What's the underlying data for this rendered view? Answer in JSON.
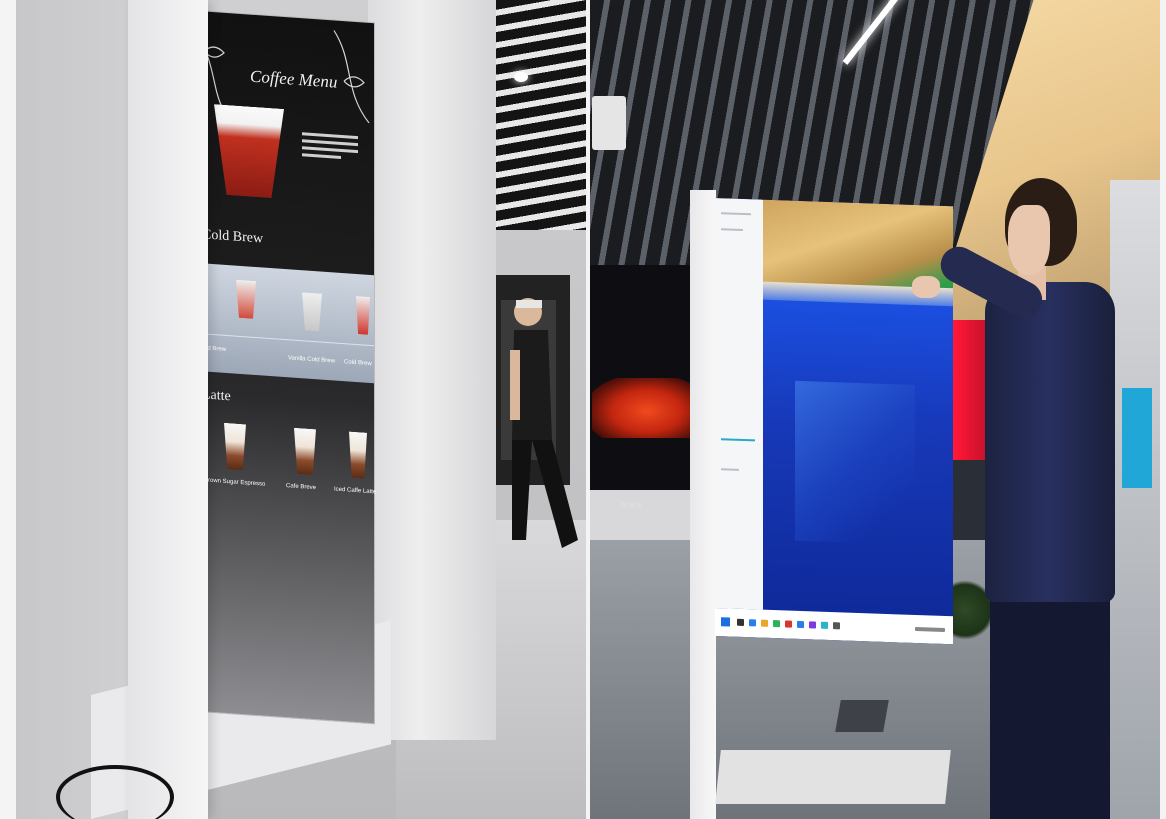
{
  "left_photo": {
    "screen": {
      "title": "Coffee Menu",
      "section_cold": "Cold Brew",
      "section_latte": "Latte",
      "cold_items": [
        "Nitro Cold Brew",
        "Vanilla Cold Brew",
        "Cold Brew"
      ],
      "latte_items": [
        "Brown Sugar Espresso",
        "Cafe Breve",
        "Iced Caffe Latte"
      ]
    }
  },
  "right_photo": {
    "screen": {
      "content": "map-application",
      "taskbar_icons": 10
    }
  },
  "colors": {
    "latte_red": "#c0301f",
    "screen_blue": "#1336c8",
    "booth_red": "#ff1836"
  }
}
